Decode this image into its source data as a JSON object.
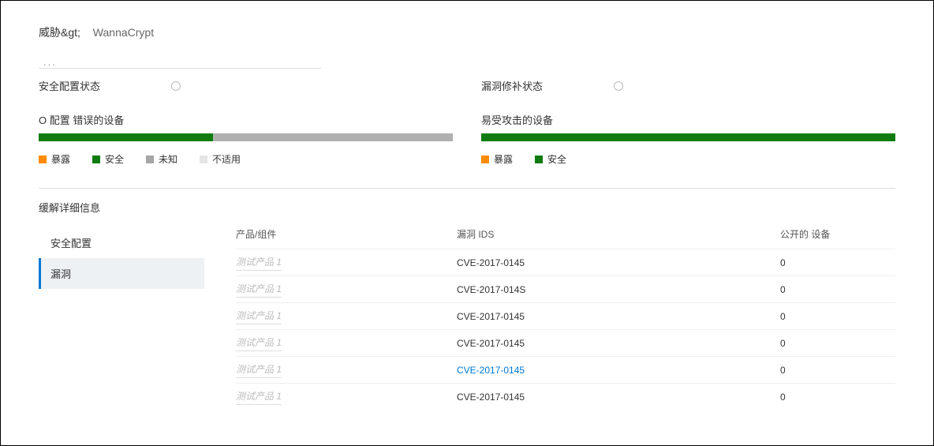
{
  "breadcrumb": {
    "label": "威胁&gt;",
    "value": "WannaCrypt"
  },
  "ellipsis": "...",
  "status_cards": {
    "left": {
      "title": "安全配置状态",
      "subheading": "O 配置 错误的设备",
      "legend": {
        "exposed": "暴露",
        "safe": "安全",
        "unknown": "未知",
        "na": "不适用"
      },
      "segments": {
        "green_pct": 42,
        "gray_pct": 58
      }
    },
    "right": {
      "title": "漏洞修补状态",
      "subheading": "易受攻击的设备",
      "legend": {
        "exposed": "暴露",
        "safe": "安全"
      },
      "segments": {
        "green_pct": 100
      }
    }
  },
  "mitigation": {
    "section_title": "缓解详细信息",
    "tabs": {
      "secure_config": "安全配置",
      "vuln": "漏洞"
    },
    "columns": {
      "product": "产品/组件",
      "cve": "漏洞 IDS",
      "devices": "公开的 设备"
    },
    "rows": [
      {
        "product": "测试产品 1",
        "cve": "CVE-2017-0145",
        "devices": "0",
        "link": false
      },
      {
        "product": "测试产品 1",
        "cve": "CVE-2017-014S",
        "devices": "0",
        "link": false
      },
      {
        "product": "测试产品 1",
        "cve": "CVE-2017-0145",
        "devices": "0",
        "link": false
      },
      {
        "product": "测试产品 1",
        "cve": "CVE-2017-0145",
        "devices": "0",
        "link": false
      },
      {
        "product": "测试产品 1",
        "cve": "CVE-2017-0145",
        "devices": "0",
        "link": true
      },
      {
        "product": "测试产品 1",
        "cve": "CVE-2017-0145",
        "devices": "0",
        "link": false
      }
    ]
  }
}
